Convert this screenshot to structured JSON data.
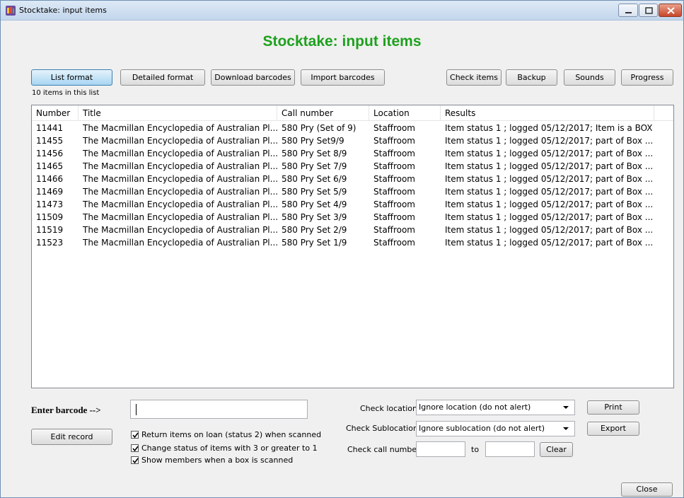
{
  "window": {
    "title": "Stocktake: input items"
  },
  "heading": "Stocktake: input items",
  "toolbar": {
    "list_format": "List format",
    "detailed_format": "Detailed format",
    "download_barcodes": "Download barcodes",
    "import_barcodes": "Import barcodes",
    "check_items": "Check items",
    "backup": "Backup",
    "sounds": "Sounds",
    "progress": "Progress"
  },
  "list": {
    "count_label": "10 items in this list",
    "columns": [
      "Number",
      "Title",
      "Call number",
      "Location",
      "Results"
    ],
    "rows": [
      [
        "11441",
        "The Macmillan Encyclopedia of Australian Pl...",
        "580 Pry (Set of 9)",
        "Staffroom",
        "Item status 1 ; logged 05/12/2017; Item is a BOX"
      ],
      [
        "11455",
        "The Macmillan Encyclopedia of Australian Pl...",
        "580 Pry Set9/9",
        "Staffroom",
        "Item status 1 ; logged 05/12/2017; part of Box ..."
      ],
      [
        "11456",
        "The Macmillan Encyclopedia of Australian Pl...",
        "580 Pry Set 8/9",
        "Staffroom",
        "Item status 1 ; logged 05/12/2017; part of Box ..."
      ],
      [
        "11465",
        "The Macmillan Encyclopedia of Australian Pl...",
        "580 Pry Set 7/9",
        "Staffroom",
        "Item status 1 ; logged 05/12/2017; part of Box ..."
      ],
      [
        "11466",
        "The Macmillan Encyclopedia of Australian Pl...",
        "580 Pry Set 6/9",
        "Staffroom",
        "Item status 1 ; logged 05/12/2017; part of Box ..."
      ],
      [
        "11469",
        "The Macmillan Encyclopedia of Australian Pl...",
        "580 Pry Set 5/9",
        "Staffroom",
        "Item status 1 ; logged 05/12/2017; part of Box ..."
      ],
      [
        "11473",
        "The Macmillan Encyclopedia of Australian Pl...",
        "580 Pry Set 4/9",
        "Staffroom",
        "Item status 1 ; logged 05/12/2017; part of Box ..."
      ],
      [
        "11509",
        "The Macmillan Encyclopedia of Australian Pl...",
        "580 Pry Set 3/9",
        "Staffroom",
        "Item status 1 ; logged 05/12/2017; part of Box ..."
      ],
      [
        "11519",
        "The Macmillan Encyclopedia of Australian Pl...",
        "580 Pry Set 2/9",
        "Staffroom",
        "Item status 1 ; logged 05/12/2017; part of Box ..."
      ],
      [
        "11523",
        "The Macmillan Encyclopedia of Australian Pl...",
        "580 Pry Set 1/9",
        "Staffroom",
        "Item status 1 ; logged 05/12/2017; part of Box ..."
      ]
    ]
  },
  "barcode": {
    "label": "Enter barcode -->",
    "value": "",
    "edit_record": "Edit record"
  },
  "options": [
    {
      "label": "Return items on loan (status 2) when scanned",
      "checked": true
    },
    {
      "label": "Change status of items with 3 or greater to 1",
      "checked": true
    },
    {
      "label": "Show members when a box is scanned",
      "checked": true
    }
  ],
  "checks": {
    "location_label": "Check location:",
    "location_value": "Ignore location (do not alert)",
    "sublocation_label": "Check Sublocation:",
    "sublocation_value": "Ignore sublocation (do not alert)",
    "callnumber_label": "Check call number:",
    "to_label": "to",
    "from_value": "",
    "to_value": "",
    "clear": "Clear"
  },
  "actions": {
    "print": "Print",
    "export": "Export",
    "close": "Close"
  },
  "colors": {
    "heading": "#1ea11e",
    "active_button": "#a7d5f2"
  }
}
